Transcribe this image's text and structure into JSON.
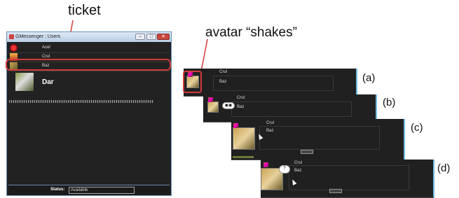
{
  "annotations": {
    "ticket_label": "ticket",
    "avatar_label": "avatar “shakes”",
    "colors": {
      "highlight": "#d23b3b"
    }
  },
  "window": {
    "title": "GMessenger : Users",
    "controls": {
      "minimize": "–",
      "maximize": "□",
      "close": "✕"
    },
    "users": [
      {
        "name": "Acel",
        "avatar_icon": "red-ninja-icon"
      },
      {
        "name": "Crul",
        "avatar_icon": "fire-icon"
      },
      {
        "name": "Baz",
        "avatar_icon": "jeep-icon"
      }
    ],
    "featured_user": {
      "name": "Dar",
      "avatar_icon": "cow-icon"
    },
    "status_label": "Status:",
    "status_value": "Available"
  },
  "frames": [
    {
      "label": "(a)",
      "name1": "Crul",
      "name2": "Baz"
    },
    {
      "label": "(b)",
      "name1": "Crul",
      "name2": "Baz"
    },
    {
      "label": "(c)",
      "name1": "Crul",
      "name2": "Baz"
    },
    {
      "label": "(d)",
      "name1": "Crul",
      "name2": "Baz",
      "bubble_text": "?"
    }
  ]
}
